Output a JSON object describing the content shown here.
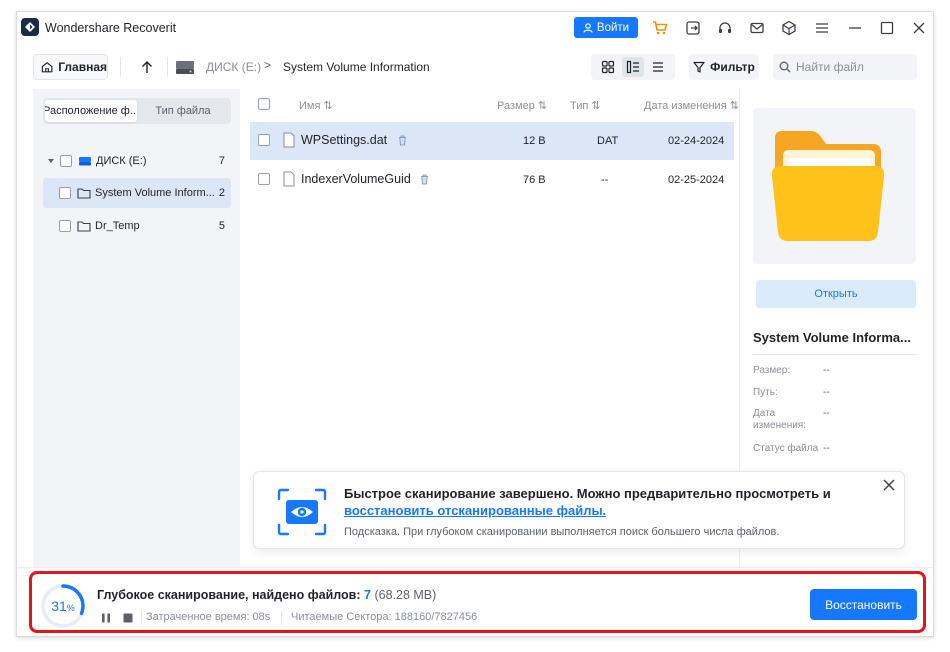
{
  "app": {
    "title": "Wondershare Recoverit",
    "login_label": "Войти"
  },
  "toolbar": {
    "home_label": "Главная",
    "breadcrumb_drive": "ДИСК (E:)",
    "breadcrumb_sep": ">",
    "breadcrumb_folder": "System Volume Information",
    "filter_label": "Фильтр",
    "search_placeholder": "Найти файл"
  },
  "sidebar": {
    "tabs": [
      {
        "label": "Расположение ф...",
        "active": true
      },
      {
        "label": "Тип файла",
        "active": false
      }
    ],
    "tree": [
      {
        "label": "ДИСК (E:)",
        "count": "7",
        "icon": "drive-icon"
      },
      {
        "label": "System Volume Inform...",
        "count": "2",
        "icon": "folder-icon",
        "selected": true
      },
      {
        "label": "Dr_Temp",
        "count": "5",
        "icon": "folder-icon"
      }
    ]
  },
  "file_list": {
    "headers": {
      "name": "Имя",
      "size": "Размер",
      "type": "Тип",
      "date": "Дата изменения"
    },
    "rows": [
      {
        "name": "WPSettings.dat",
        "size": "12 B",
        "type": "DAT",
        "date": "02-24-2024",
        "selected": true
      },
      {
        "name": "IndexerVolumeGuid",
        "size": "76 B",
        "type": "--",
        "date": "02-25-2024",
        "selected": false
      }
    ]
  },
  "details": {
    "open_label": "Открыть",
    "title": "System Volume Informa...",
    "fields": [
      {
        "label": "Размер:",
        "value": "--"
      },
      {
        "label": "Путь:",
        "value": "--"
      },
      {
        "label": "Дата изменения:",
        "value": "--"
      },
      {
        "label": "Статус файла",
        "value": "--"
      }
    ]
  },
  "toast": {
    "line1": "Быстрое сканирование завершено. Можно предварительно просмотреть и",
    "link": "восстановить отсканированные файлы.",
    "hint": "Подсказка. При глубоком сканировании выполняется поиск большего числа файлов."
  },
  "status": {
    "percent": 31,
    "percent_number": "31",
    "percent_sign": "%",
    "title_prefix": "Глубокое сканирование, найдено файлов:",
    "found_count": "7",
    "found_size": "(68.28 MB)",
    "elapsed": "Затраченное время: 08s",
    "sectors": "Читаемые Сектора: 188160/7827456",
    "restore_label": "Восстановить"
  },
  "colors": {
    "accent": "#1677ff",
    "highlight": "#e3141b",
    "folder": "#f8b400"
  }
}
